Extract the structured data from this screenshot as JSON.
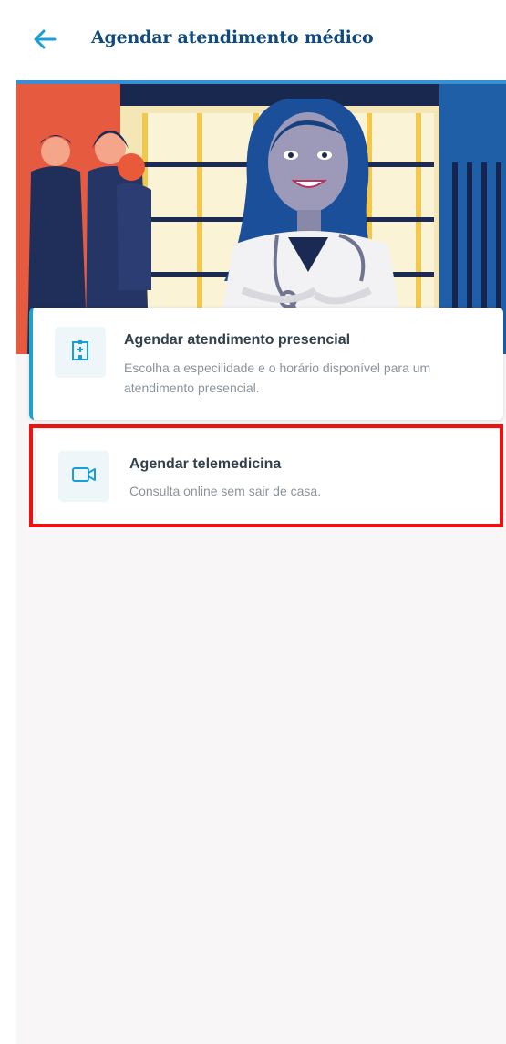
{
  "header": {
    "back_icon": "arrow-left-icon",
    "title": "Agendar atendimento médico"
  },
  "hero": {
    "image": "doctor-and-patients-illustration"
  },
  "options": [
    {
      "icon": "hospital-building-icon",
      "title": "Agendar atendimento presencial",
      "description": "Escolha a especilidade e o horário disponível para um atendimento presencial."
    },
    {
      "icon": "video-camera-icon",
      "title": "Agendar telemedicina",
      "description": "Consulta online sem sair de casa."
    }
  ],
  "colors": {
    "title": "#0f4b7f",
    "accent": "#1aa3c8",
    "highlight": "#ee1111",
    "background": "#f8f6f7"
  }
}
